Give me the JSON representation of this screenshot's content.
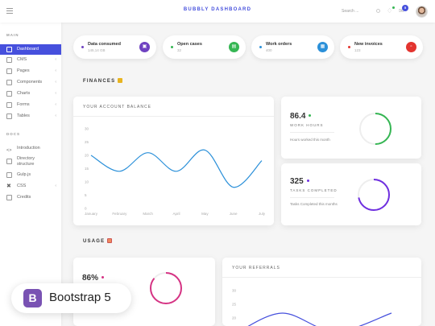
{
  "topbar": {
    "brand": "BUBBLY DASHBOARD",
    "search_placeholder": "Search ...",
    "notification_badge": "5"
  },
  "sidebar": {
    "main_heading": "MAIN",
    "main_items": [
      {
        "label": "Dashboard",
        "active": true,
        "chevron": false
      },
      {
        "label": "CMS",
        "chevron": true
      },
      {
        "label": "Pages",
        "chevron": true
      },
      {
        "label": "Components",
        "chevron": true
      },
      {
        "label": "Charts",
        "chevron": true
      },
      {
        "label": "Forms",
        "chevron": true
      },
      {
        "label": "Tables",
        "chevron": true
      }
    ],
    "docs_heading": "DOCS",
    "docs_items": [
      {
        "label": "Introduction"
      },
      {
        "label": "Directory structure"
      },
      {
        "label": "Gulp.js"
      },
      {
        "label": "CSS",
        "chevron": true
      },
      {
        "label": "Credits"
      }
    ]
  },
  "stats": [
    {
      "title": "Data consumed",
      "sub": "145,14 GB",
      "color": "#6f42c1",
      "icon": "database-icon"
    },
    {
      "title": "Open cases",
      "sub": "32",
      "color": "#35b653",
      "icon": "file-icon"
    },
    {
      "title": "Work orders",
      "sub": "400",
      "color": "#2b90d9",
      "icon": "clipboard-icon"
    },
    {
      "title": "New invoices",
      "sub": "123",
      "color": "#e3342f",
      "icon": "receipt-icon"
    }
  ],
  "finances": {
    "title": "FINANCES",
    "balance_title": "YOUR ACCOUNT BALANCE",
    "work_hours": {
      "value": "86.4",
      "label": "WORK HOURS",
      "note": "Hours worked this month",
      "color": "#35b653",
      "progress": 0.5
    },
    "tasks": {
      "value": "325",
      "label": "TASKS COMPLETED",
      "note": "Tasks Completed this months",
      "color": "#6f2fe0",
      "progress": 0.72
    }
  },
  "usage": {
    "title": "USAGE",
    "percent": {
      "value": "86%",
      "color": "#d63384",
      "progress": 0.86
    },
    "referrals_title": "YOUR REFERRALS"
  },
  "chart_data": [
    {
      "type": "line",
      "title": "YOUR ACCOUNT BALANCE",
      "categories": [
        "January",
        "February",
        "March",
        "April",
        "May",
        "June",
        "July"
      ],
      "yticks": [
        0,
        5,
        10,
        15,
        20,
        25,
        30
      ],
      "ylim": [
        0,
        30
      ],
      "series": [
        {
          "values": [
            20,
            14,
            21,
            14,
            22,
            8,
            18
          ],
          "color": "#2b90d9"
        }
      ]
    },
    {
      "type": "line",
      "title": "YOUR REFERRALS",
      "yticks": [
        20,
        25,
        30
      ],
      "ylim": [
        15,
        32
      ],
      "series": [
        {
          "values": [
            15,
            20,
            15,
            20
          ],
          "color": "#4650dd"
        }
      ]
    }
  ],
  "promo": {
    "logo": "B",
    "text": "Bootstrap 5"
  }
}
